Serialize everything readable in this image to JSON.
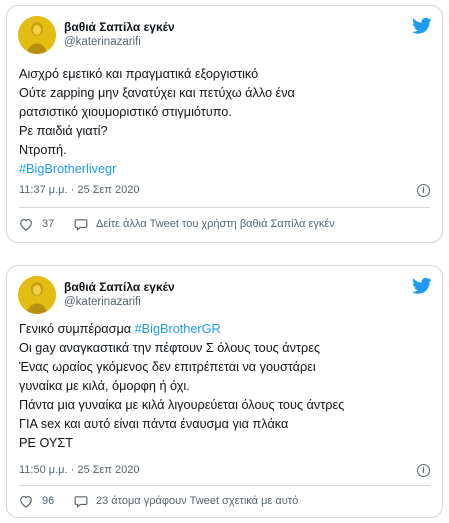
{
  "colors": {
    "accent": "#1d9bf0",
    "text": "#0f1419",
    "muted": "#536471",
    "border": "#cfd9de"
  },
  "tweets": [
    {
      "author_name": "βαθιά Σαπίλα εγκέν",
      "handle": "@katerinazarifi",
      "lines": [
        "Αισχρό εμετικό και πραγματικά εξοργιστικό",
        "Ούτε zapping μην ξανατύχει και πετύχω άλλο ένα",
        "ρατσιστικό χιουμοριστικό στιγμιότυπο.",
        "Ρε παιδιά γιατί?",
        "Ντροπή."
      ],
      "hashtag_line": "#BigBrotherlivegr",
      "timestamp": "11:37 μ.μ. · 25 Σεπ 2020",
      "like_count": "37",
      "action_text": "Δείτε άλλα Tweet του χρήστη βαθιά Σαπίλα εγκέν",
      "icons": {
        "brand": "twitter-bird-icon",
        "info": "info-icon",
        "like": "heart-icon",
        "reply": "speech-bubble-icon"
      }
    },
    {
      "author_name": "βαθιά Σαπίλα εγκέν",
      "handle": "@katerinazarifi",
      "first_line_text": "Γενικό συμπέρασμα ",
      "first_line_hashtag": "#BigBrotherGR",
      "lines": [
        "Οι gay αναγκαστικά την πέφτουν Σ όλους τους άντρες",
        "Ένας ωραίος γκόμενος δεν επιτρέπεται να γουστάρει",
        "γυναίκα με κιλά, όμορφη ή όχι.",
        "Πάντα μια γυναίκα με κιλά λιγουρεύεται όλους τους άντρες",
        "ΓΙΑ sex και αυτό είναι πάντα έναυσμα για πλάκα",
        "ΡΕ ΟΥΣΤ"
      ],
      "timestamp": "11:50 μ.μ. · 25 Σεπ 2020",
      "like_count": "96",
      "action_text": "23 άτομα γράφουν Tweet σχετικά με αυτό",
      "icons": {
        "brand": "twitter-bird-icon",
        "info": "info-icon",
        "like": "heart-icon",
        "reply": "speech-bubble-icon"
      }
    }
  ]
}
